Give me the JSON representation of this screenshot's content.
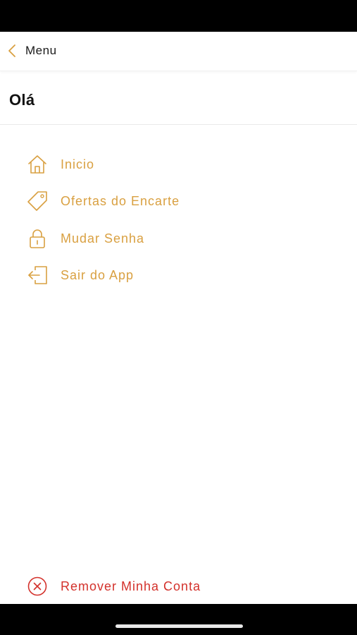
{
  "header": {
    "back_label": "Menu",
    "back_icon": "chevron-left-icon"
  },
  "greeting": "Olá",
  "menu": {
    "items": [
      {
        "label": "Inicio",
        "icon": "home-icon"
      },
      {
        "label": "Ofertas do Encarte",
        "icon": "tag-icon"
      },
      {
        "label": "Mudar Senha",
        "icon": "lock-icon"
      },
      {
        "label": "Sair do App",
        "icon": "logout-icon"
      }
    ]
  },
  "footer": {
    "remove_account_label": "Remover Minha Conta",
    "remove_icon": "close-circle-icon"
  },
  "colors": {
    "accent": "#d9a041",
    "danger": "#d3312b",
    "text": "#111111",
    "bars": "#000000"
  }
}
